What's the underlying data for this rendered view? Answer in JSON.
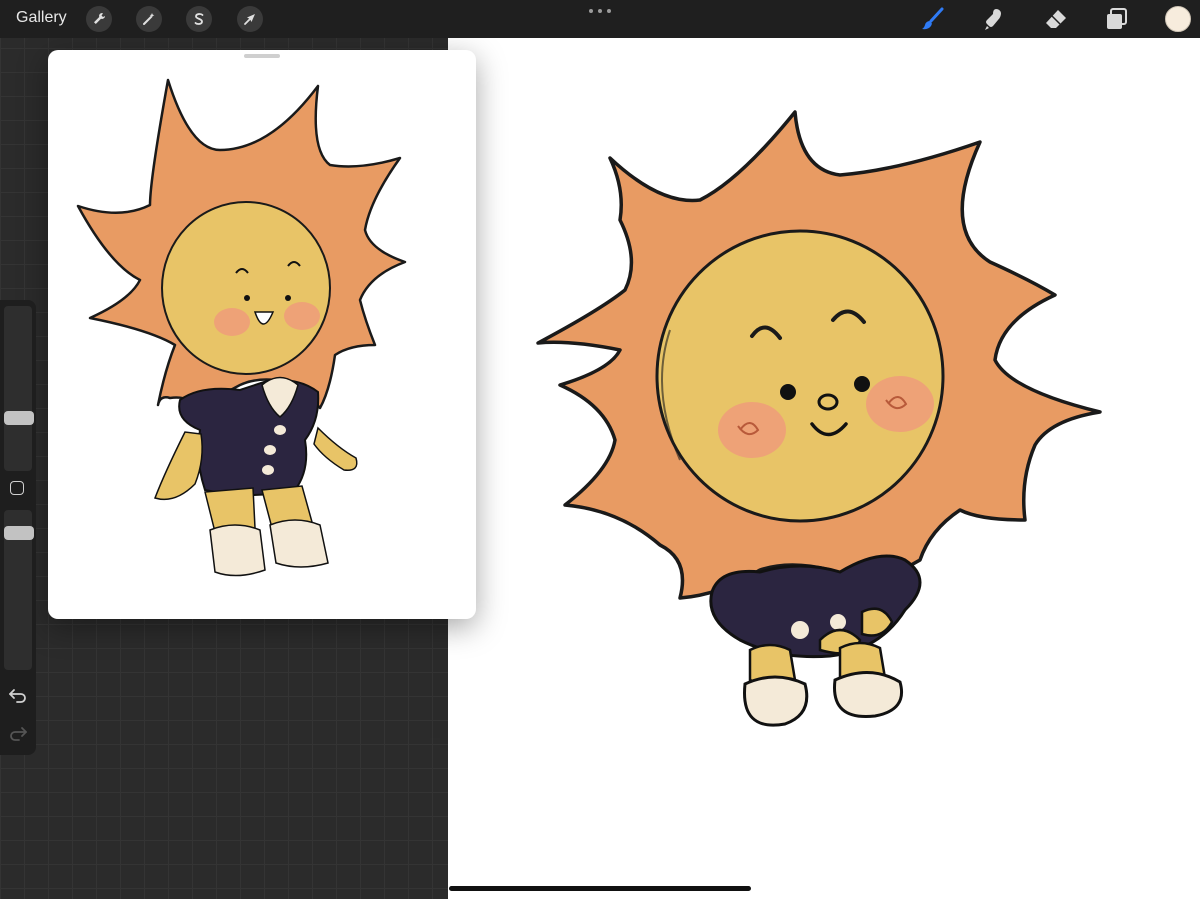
{
  "topbar": {
    "gallery_label": "Gallery",
    "actions_icon": "wrench-icon",
    "adjustments_icon": "magic-wand-icon",
    "selection_icon": "selection-s-icon",
    "transform_icon": "arrow-cursor-icon",
    "more_icon": "more-dots-icon",
    "tools": [
      {
        "name": "brush",
        "icon": "brush-icon",
        "active": true
      },
      {
        "name": "smudge",
        "icon": "smudge-icon",
        "active": false
      },
      {
        "name": "eraser",
        "icon": "eraser-icon",
        "active": false
      },
      {
        "name": "layers",
        "icon": "layers-icon",
        "active": false
      }
    ],
    "current_color": "#f7ecdd",
    "accent_color": "#2f7bf5"
  },
  "sidebar": {
    "brush_size_icon": "size-slider-icon",
    "modify_icon": "square-modify-icon",
    "opacity_icon": "opacity-slider-icon",
    "undo_icon": "undo-icon",
    "redo_icon": "redo-icon"
  },
  "canvas": {
    "main_art": "sun-character-sketch",
    "reference_art": "sun-character-full-body"
  },
  "colors": {
    "sun_orange": "#e89b63",
    "face_yellow": "#e8c467",
    "dress_navy": "#2b2540",
    "cheek_pink": "#ef9c7a",
    "shoe_cream": "#f4ead8"
  }
}
